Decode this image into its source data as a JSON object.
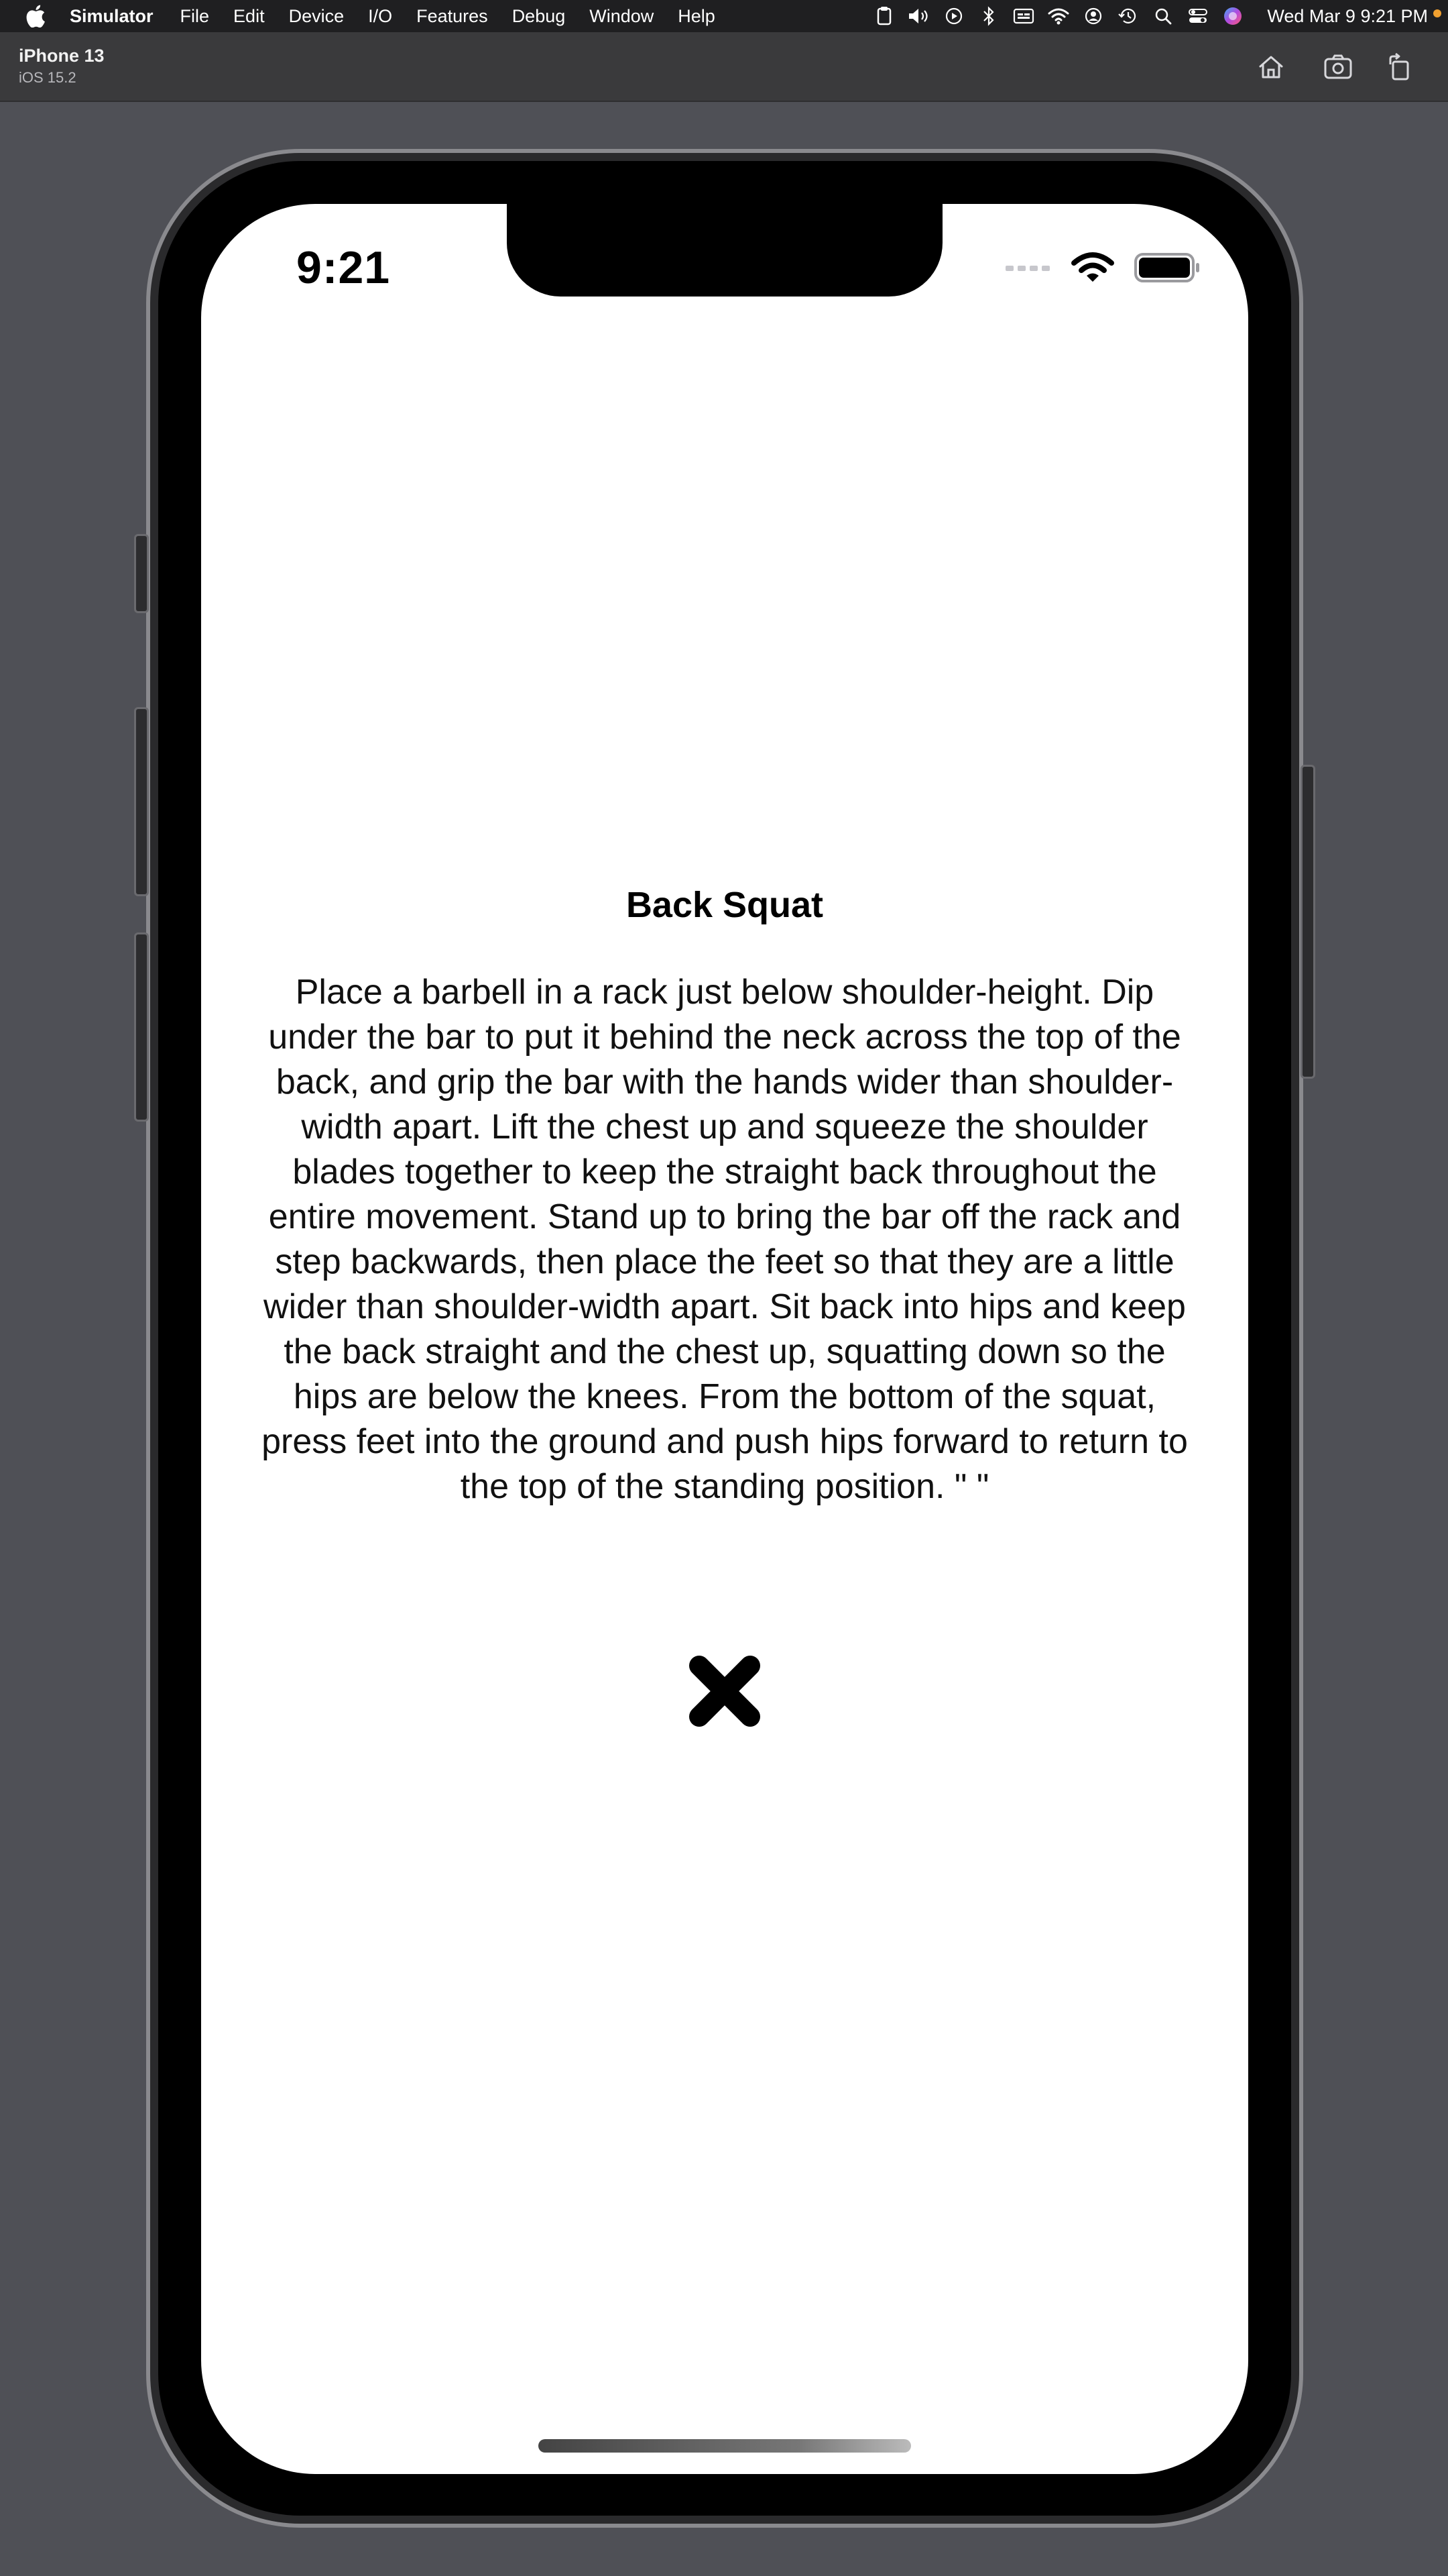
{
  "menubar": {
    "app_name": "Simulator",
    "items": [
      "File",
      "Edit",
      "Device",
      "I/O",
      "Features",
      "Debug",
      "Window",
      "Help"
    ],
    "clock": "Wed Mar 9  9:21 PM"
  },
  "toolbar": {
    "device_name": "iPhone 13",
    "os_version": "iOS 15.2"
  },
  "status_bar": {
    "time": "9:21"
  },
  "exercise": {
    "title": "Back Squat",
    "description": "Place a barbell in a rack just below shoulder-height. Dip under the bar to put it behind the neck across the top of the back, and grip the bar with the hands wider than shoulder-width apart. Lift the chest up and squeeze the shoulder blades together to keep the straight back throughout the entire movement. Stand up to bring the bar off the rack and step backwards, then place the feet so that they are a little wider than shoulder-width apart. Sit back into hips and keep the back straight and the chest up, squatting down so the hips are below the knees. From the bottom of the squat, press feet into the ground and push hips forward to return to the top of the standing position. \" \""
  },
  "icons": {
    "close": "close-x-icon"
  },
  "colors": {
    "menubar_bg": "#1f1f21",
    "toolbar_bg": "#3a3a3c",
    "desktop_bg": "#4f5056",
    "screen_bg": "#ffffff",
    "text": "#000000"
  }
}
